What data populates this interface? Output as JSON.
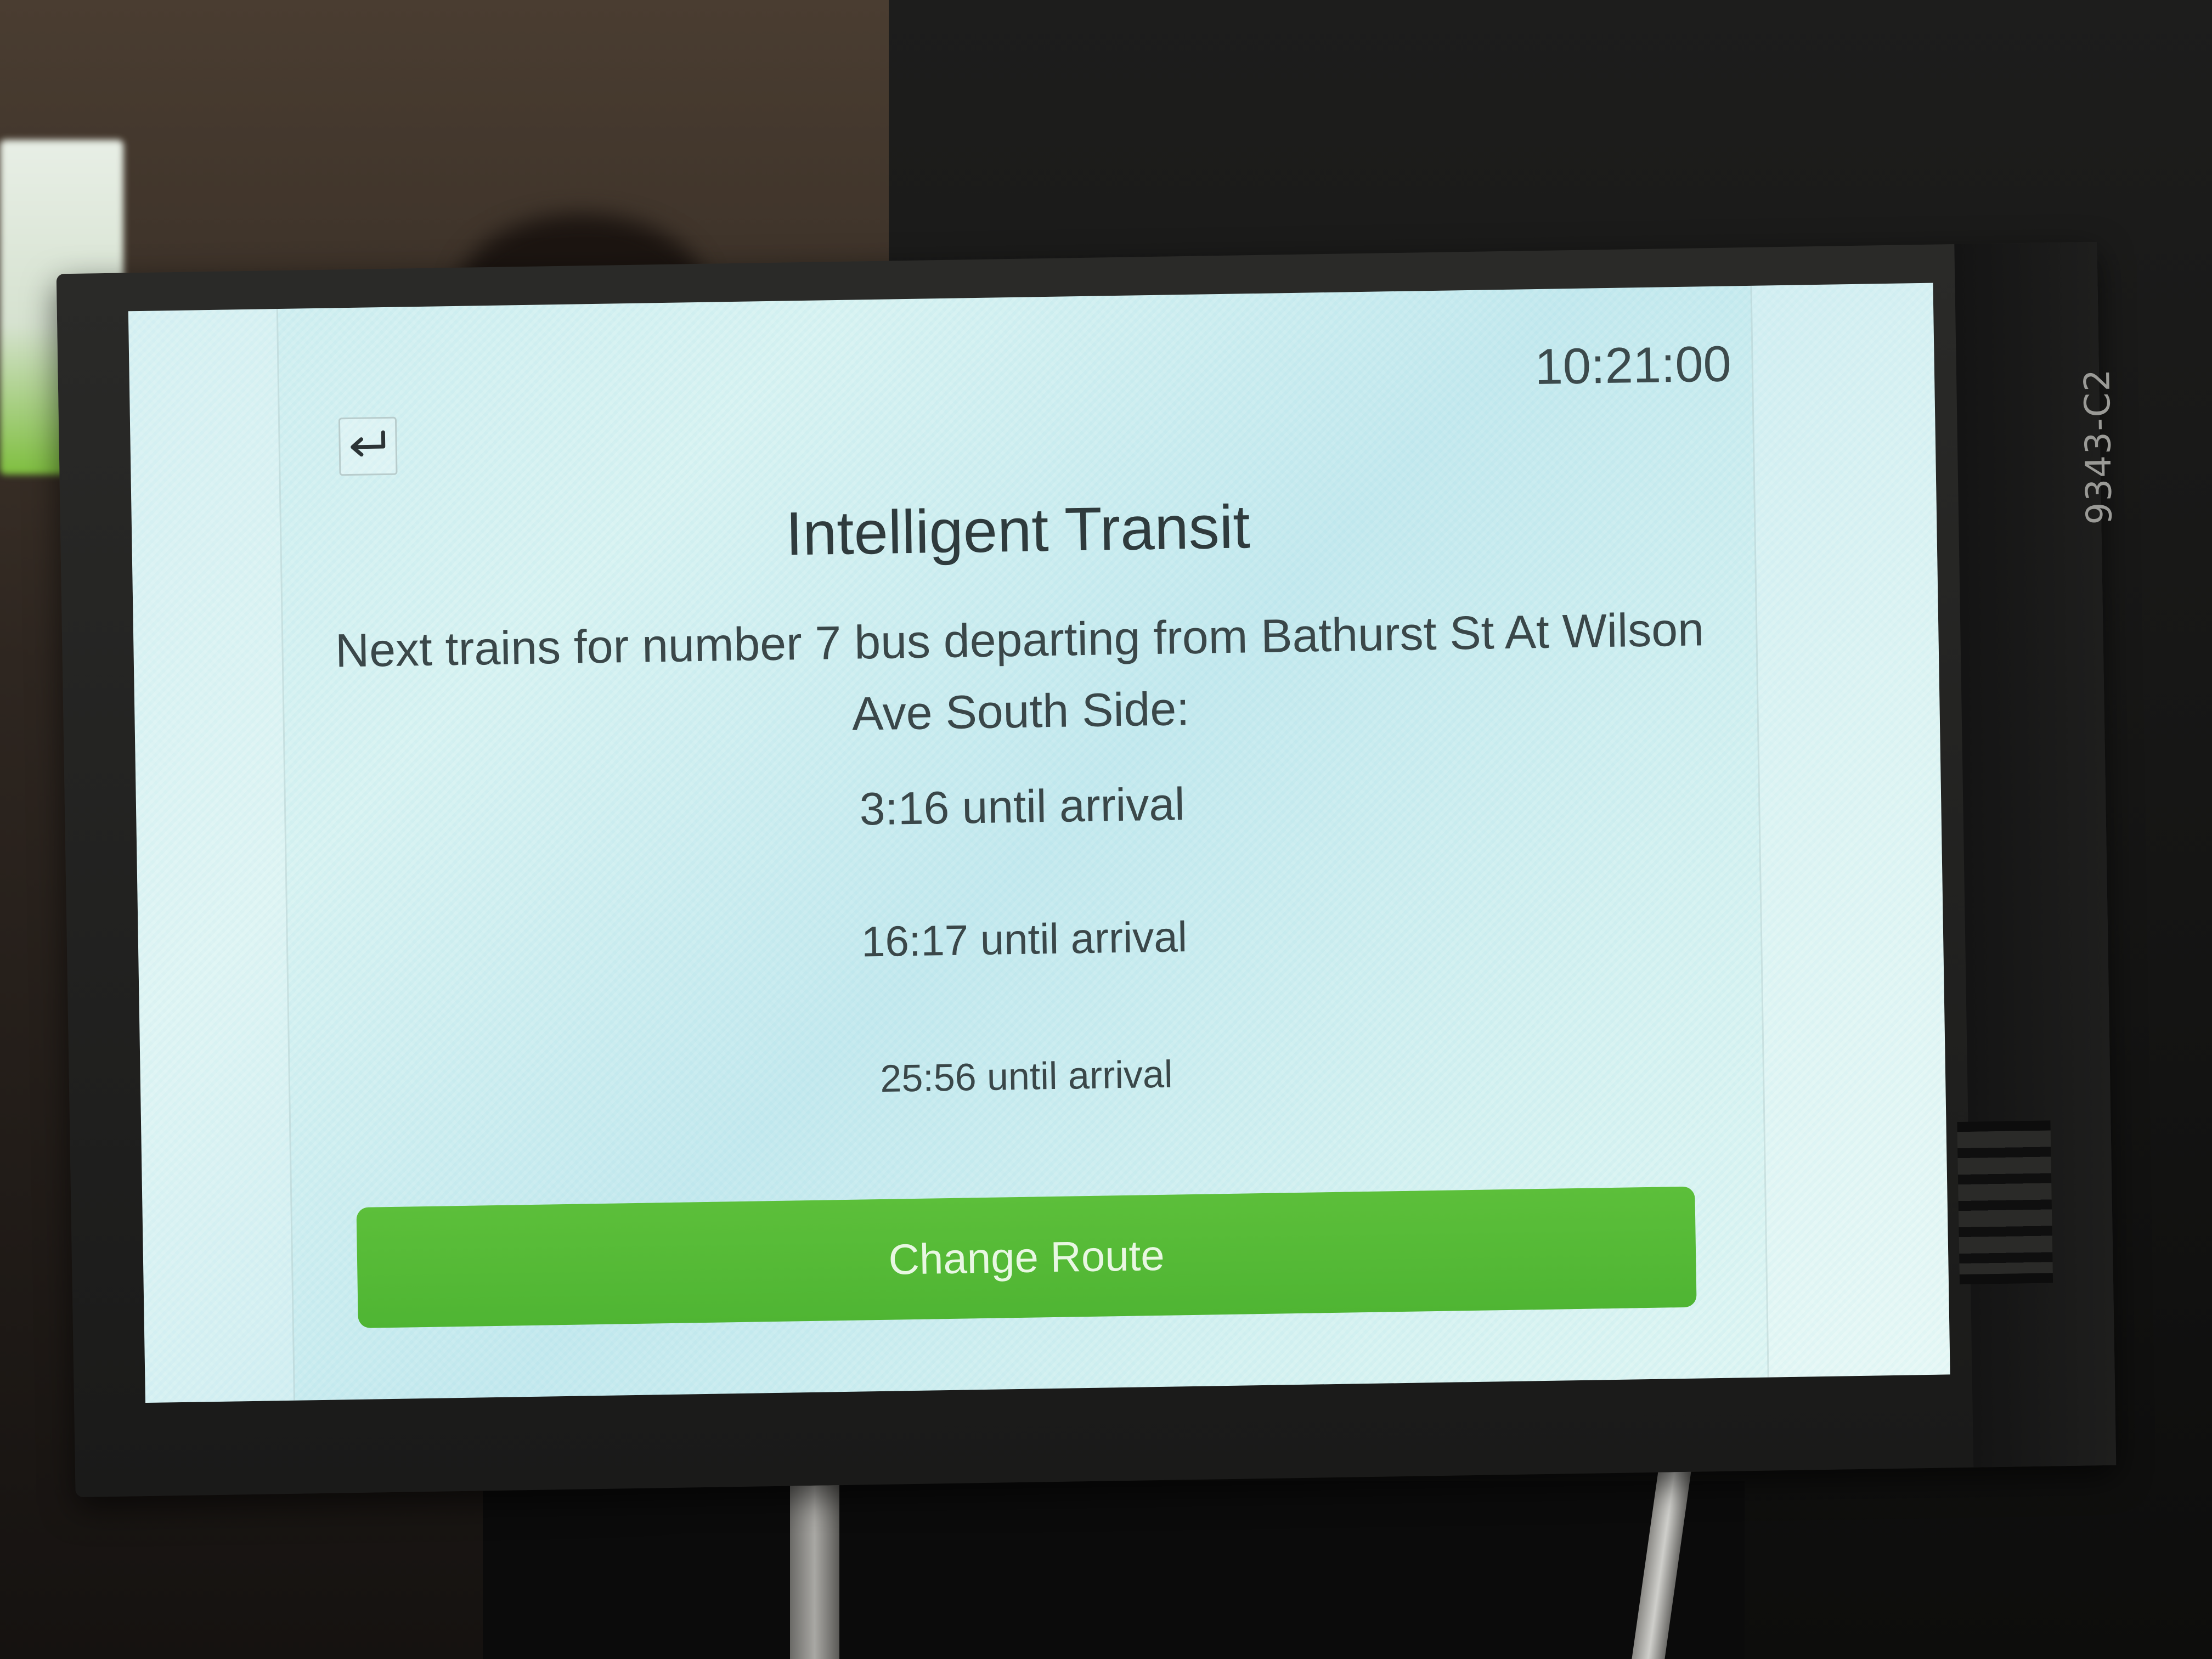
{
  "device": {
    "model_label": "9343-C2"
  },
  "app": {
    "clock": "10:21:00",
    "back_icon": "return-arrow-icon",
    "title": "Intelligent Transit",
    "subtitle": "Next trains for number 7 bus departing from Bathurst St At Wilson Ave South Side:",
    "arrivals": [
      {
        "text": "3:16 until arrival"
      },
      {
        "text": "16:17 until arrival"
      },
      {
        "text": "25:56 until arrival"
      }
    ],
    "change_route_label": "Change Route",
    "accent_color": "#4fb533"
  }
}
